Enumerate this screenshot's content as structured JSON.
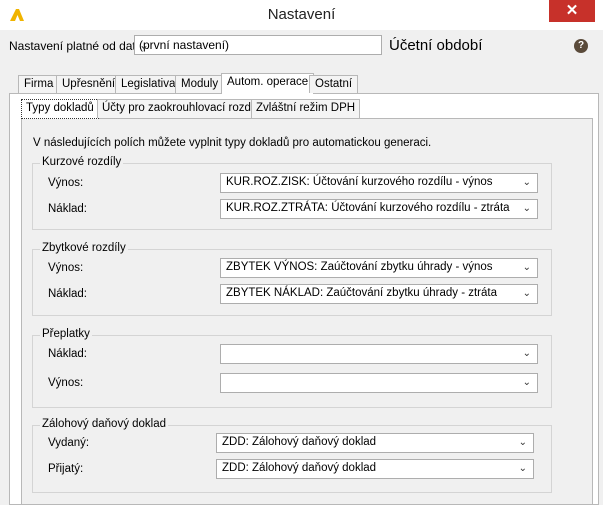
{
  "window": {
    "title": "Nastavení",
    "close_symbol": "✕"
  },
  "period": {
    "label": "Nastavení platné od data:",
    "value": "(první nastavení)",
    "heading": "Účetní období",
    "help_symbol": "?"
  },
  "tabs": [
    "Firma",
    "Upřesnění",
    "Legislativa",
    "Moduly",
    "Autom. operace",
    "Ostatní"
  ],
  "active_tab": "Autom. operace",
  "subtabs": [
    "Typy dokladů",
    "Účty pro zaokrouhlovací rozdíl",
    "Zvláštní režim DPH"
  ],
  "active_subtab": "Typy dokladů",
  "intro": "V následujících polích můžete vyplnit typy dokladů pro automatickou generaci.",
  "groups": [
    {
      "title": "Kurzové rozdíly",
      "fields": [
        {
          "label": "Výnos:",
          "value": "KUR.ROZ.ZISK: Účtování kurzového rozdílu - výnos"
        },
        {
          "label": "Náklad:",
          "value": "KUR.ROZ.ZTRÁTA: Účtování kurzového rozdílu - ztráta"
        }
      ]
    },
    {
      "title": "Zbytkové rozdíly",
      "fields": [
        {
          "label": "Výnos:",
          "value": "ZBYTEK VÝNOS: Zaúčtování zbytku úhrady - výnos"
        },
        {
          "label": "Náklad:",
          "value": "ZBYTEK NÁKLAD: Zaúčtování zbytku úhrady - ztráta"
        }
      ]
    },
    {
      "title": "Přeplatky",
      "fields": [
        {
          "label": "Náklad:",
          "value": ""
        },
        {
          "label": "Výnos:",
          "value": ""
        }
      ]
    },
    {
      "title": "Zálohový daňový doklad",
      "fields": [
        {
          "label": "Vydaný:",
          "value": "ZDD: Zálohový daňový doklad"
        },
        {
          "label": "Přijatý:",
          "value": "ZDD: Zálohový daňový doklad"
        }
      ]
    }
  ],
  "colors": {
    "close_button": "#c7312a",
    "logo": "#f0b400"
  }
}
